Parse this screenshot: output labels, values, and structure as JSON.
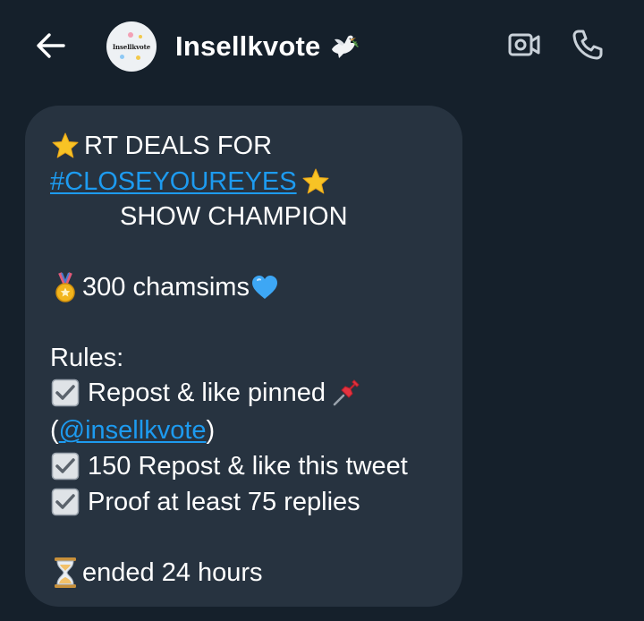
{
  "header": {
    "back_icon": "arrow-left-icon",
    "avatar_text": "Insellkvote",
    "name": "Insellkvote",
    "name_emoji": "dove-icon",
    "video_icon": "video-camera-icon",
    "call_icon": "phone-icon"
  },
  "message": {
    "line1_text": "RT DEALS FOR",
    "line1_emoji": "star-icon",
    "hashtag": "#CLOSEYOUREYES",
    "hashtag_emoji": "star-icon",
    "line3_text": "SHOW CHAMPION",
    "prize_text": "300 chamsims",
    "prize_emoji_before": "medal-icon",
    "prize_emoji_after": "blue-heart-icon",
    "rules_title": "Rules:",
    "rule1_text": "Repost & like pinned",
    "rule1_emoji_after": "pushpin-icon",
    "rule1_mention_open": "(",
    "rule1_mention": "@insellkvote",
    "rule1_mention_close": ")",
    "rule2_text": "150 Repost & like this tweet",
    "rule3_text": "Proof at least 75 replies",
    "check_icon": "check-box-icon",
    "deadline_text": "ended 24 hours",
    "deadline_emoji": "hourglass-icon"
  },
  "colors": {
    "background": "#15202b",
    "bubble": "#273340",
    "link": "#1d9bf0",
    "icon": "#c9d1d9"
  }
}
